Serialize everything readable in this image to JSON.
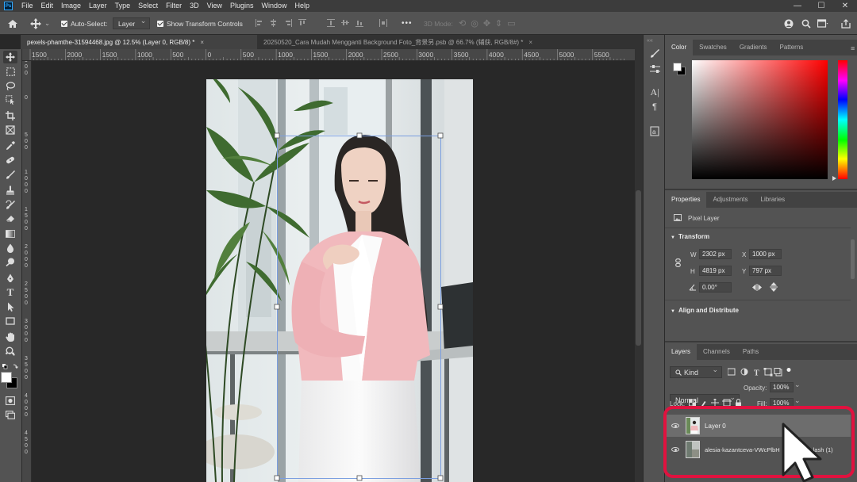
{
  "menubar": {
    "logo": "Ps",
    "items": [
      "File",
      "Edit",
      "Image",
      "Layer",
      "Type",
      "Select",
      "Filter",
      "3D",
      "View",
      "Plugins",
      "Window",
      "Help"
    ],
    "window_controls": [
      "—",
      "☐",
      "✕"
    ]
  },
  "options": {
    "auto_select_label": "Auto-Select:",
    "auto_select_target": "Layer",
    "show_transform_label": "Show Transform Controls",
    "more": "•••",
    "mode_3d": "3D Mode:"
  },
  "tabs": [
    {
      "label": "pexels-phamthe-31594468.jpg @ 12.5% (Layer 0, RGB/8) *",
      "close": "×"
    },
    {
      "label": "20250520_Cara Mudah Mengganti Background Foto_背景另.psb @ 66.7% (辅获, RGB/8#) *",
      "close": "×"
    }
  ],
  "ruler_h": [
    "1500",
    "2000",
    "1500",
    "1000",
    "500",
    "0",
    "500",
    "1000",
    "1500",
    "2000",
    "2500",
    "3000",
    "3500",
    "4000",
    "4500",
    "5000",
    "5500"
  ],
  "ruler_v": [
    "5\n0\n0",
    "0",
    "5\n0\n0",
    "1\n0\n0\n0",
    "1\n5\n0\n0",
    "2\n0\n0\n0",
    "2\n5\n0\n0",
    "3\n0\n0\n0",
    "3\n5\n0\n0",
    "4\n0\n0\n0",
    "4\n5\n0\n0"
  ],
  "color_panel": {
    "tabs": [
      "Color",
      "Swatches",
      "Gradients",
      "Patterns"
    ],
    "active_hue": "#ff0000"
  },
  "properties_panel": {
    "tabs": [
      "Properties",
      "Adjustments",
      "Libraries"
    ],
    "layer_type": "Pixel Layer",
    "transform_title": "Transform",
    "w_label": "W",
    "w_value": "2302 px",
    "x_label": "X",
    "x_value": "1000 px",
    "h_label": "H",
    "h_value": "4819 px",
    "y_label": "Y",
    "y_value": "797 px",
    "angle_value": "0.00°",
    "align_title": "Align and Distribute"
  },
  "layers_panel": {
    "tabs": [
      "Layers",
      "Channels",
      "Paths"
    ],
    "kind_filter": "Kind",
    "blend_mode": "Normal",
    "opacity_label": "Opacity:",
    "opacity_value": "100%",
    "lock_label": "Lock:",
    "fill_label": "Fill:",
    "fill_value": "100%",
    "layers": [
      {
        "name": "Layer 0",
        "selected": true
      },
      {
        "name": "alesia-kazantceva-VWcPlbH",
        "suffix": "lash (1)",
        "selected": false
      }
    ],
    "highlight_color": "#e0123f"
  }
}
